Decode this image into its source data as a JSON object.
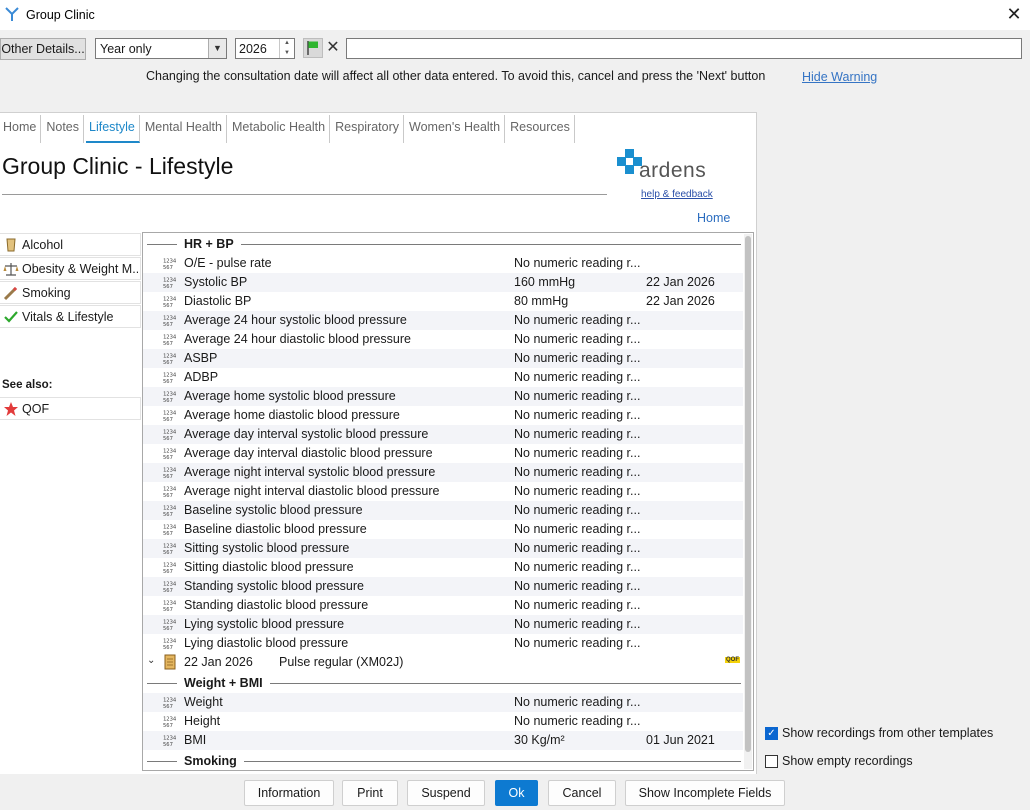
{
  "window": {
    "title": "Group Clinic"
  },
  "toolbar": {
    "other_details_label": "Other Details...",
    "period_value": "Year only",
    "year_value": "2026",
    "free_text_value": ""
  },
  "warning": {
    "message": "Changing the consultation date will affect all other data entered. To avoid this, cancel and press the 'Next' button",
    "hide_label": "Hide Warning"
  },
  "tabs": [
    "Home",
    "Notes",
    "Lifestyle",
    "Mental Health",
    "Metabolic Health",
    "Respiratory",
    "Women's Health",
    "Resources"
  ],
  "active_tab": "Lifestyle",
  "page": {
    "title": "Group Clinic - Lifestyle",
    "logo_text": "ardens",
    "help_label": "help & feedback",
    "home_label": "Home"
  },
  "nav": {
    "items": [
      {
        "label": "Alcohol",
        "icon": "bottle-icon"
      },
      {
        "label": "Obesity & Weight M...",
        "icon": "scales-icon"
      },
      {
        "label": "Smoking",
        "icon": "cigarette-icon"
      },
      {
        "label": "Vitals & Lifestyle",
        "icon": "check-icon"
      }
    ],
    "see_also_label": "See also:",
    "qof_label": "QOF"
  },
  "sections": {
    "hr_bp": "HR + BP",
    "weight_bmi": "Weight + BMI",
    "smoking": "Smoking"
  },
  "hr_bp_rows": [
    {
      "name": "O/E - pulse rate",
      "value": "No numeric reading r...",
      "date": ""
    },
    {
      "name": "Systolic BP",
      "value": "160 mmHg",
      "date": "22 Jan 2026"
    },
    {
      "name": "Diastolic BP",
      "value": "80 mmHg",
      "date": "22 Jan 2026"
    },
    {
      "name": "Average 24 hour systolic blood pressure",
      "value": "No numeric reading r...",
      "date": ""
    },
    {
      "name": "Average 24 hour diastolic blood pressure",
      "value": "No numeric reading r...",
      "date": ""
    },
    {
      "name": "ASBP",
      "value": "No numeric reading r...",
      "date": ""
    },
    {
      "name": "ADBP",
      "value": "No numeric reading r...",
      "date": ""
    },
    {
      "name": "Average home systolic blood pressure",
      "value": "No numeric reading r...",
      "date": ""
    },
    {
      "name": "Average home diastolic blood pressure",
      "value": "No numeric reading r...",
      "date": ""
    },
    {
      "name": "Average day interval systolic blood pressure",
      "value": "No numeric reading r...",
      "date": ""
    },
    {
      "name": "Average day interval diastolic blood pressure",
      "value": "No numeric reading r...",
      "date": ""
    },
    {
      "name": "Average night interval systolic blood pressure",
      "value": "No numeric reading r...",
      "date": ""
    },
    {
      "name": "Average night interval diastolic blood pressure",
      "value": "No numeric reading r...",
      "date": ""
    },
    {
      "name": "Baseline systolic blood pressure",
      "value": "No numeric reading r...",
      "date": ""
    },
    {
      "name": "Baseline diastolic blood pressure",
      "value": "No numeric reading r...",
      "date": ""
    },
    {
      "name": "Sitting systolic blood pressure",
      "value": "No numeric reading r...",
      "date": ""
    },
    {
      "name": "Sitting diastolic blood pressure",
      "value": "No numeric reading r...",
      "date": ""
    },
    {
      "name": "Standing systolic blood pressure",
      "value": "No numeric reading r...",
      "date": ""
    },
    {
      "name": "Standing diastolic blood pressure",
      "value": "No numeric reading r...",
      "date": ""
    },
    {
      "name": "Lying systolic blood pressure",
      "value": "No numeric reading r...",
      "date": ""
    },
    {
      "name": "Lying diastolic blood pressure",
      "value": "No numeric reading r...",
      "date": ""
    }
  ],
  "recording": {
    "date": "22 Jan 2026",
    "text": "Pulse regular (XM02J)",
    "badge": "QOF"
  },
  "weight_rows": [
    {
      "name": "Weight",
      "value": "No numeric reading r...",
      "date": ""
    },
    {
      "name": "Height",
      "value": "No numeric reading r...",
      "date": ""
    },
    {
      "name": "BMI",
      "value": "30 Kg/m²",
      "date": "01 Jun 2021"
    }
  ],
  "options": {
    "show_other_templates": {
      "label": "Show recordings from other templates",
      "checked": true
    },
    "show_empty": {
      "label": "Show empty recordings",
      "checked": false
    }
  },
  "buttons": {
    "information": "Information",
    "print": "Print",
    "suspend": "Suspend",
    "ok": "Ok",
    "cancel": "Cancel",
    "incomplete": "Show Incomplete Fields"
  }
}
